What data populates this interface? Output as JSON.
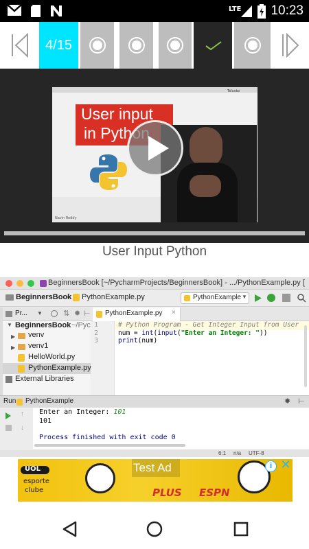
{
  "status_bar": {
    "time": "10:23",
    "network": "LTE",
    "icons": [
      "gmail-icon",
      "sd-card-icon",
      "n-icon",
      "lte-signal-icon",
      "battery-icon"
    ]
  },
  "nav": {
    "counter": "4/15",
    "accent": "#00e5ff",
    "check_color": "#8bc34a"
  },
  "video": {
    "thumbnail_title_line1": "User input",
    "thumbnail_title_line2": "in Python",
    "thumbnail_brand": "Telusko",
    "thumbnail_presenter": "Navin Reddy",
    "progress": 0.0
  },
  "lesson": {
    "title": "User Input Python"
  },
  "ide": {
    "window_title": "BeginnersBook [~/PycharmProjects/BeginnersBook] - .../PythonExample.py [",
    "breadcrumb_project": "BeginnersBook",
    "breadcrumb_file": "PythonExample.py",
    "run_config": "PythonExample",
    "project_label": "Pr...",
    "editor_tab": "PythonExample.py",
    "tree": {
      "root": "BeginnersBook",
      "root_path": "~/Pyc",
      "items": [
        "venv",
        "venv1",
        "HelloWorld.py",
        "PythonExample.py"
      ],
      "external": "External Libraries"
    },
    "code": {
      "line_numbers": [
        "1",
        "2",
        "3"
      ],
      "line1": "# Python Program - Get Integer Input from User",
      "line2_a": "num = ",
      "line2_int": "int",
      "line2_b": "(",
      "line2_input": "input",
      "line2_c": "(",
      "line2_str": "\"Enter an Integer: \"",
      "line2_d": "))",
      "line3_print": "print",
      "line3_b": "(num)"
    },
    "run": {
      "label": "Run",
      "config": "PythonExample",
      "prompt": "Enter an Integer: ",
      "input_value": "101",
      "output_value": "101",
      "exit_message": "Process finished with exit code 0"
    },
    "statusline": {
      "position": "6:1",
      "na": "n/a",
      "encoding": "UTF-8"
    }
  },
  "ad": {
    "label": "Test Ad",
    "brand1": "UOL",
    "brand1_sub1": "esporte",
    "brand1_sub2": "clube",
    "brand2": "PLUS",
    "brand3": "ESPN"
  }
}
